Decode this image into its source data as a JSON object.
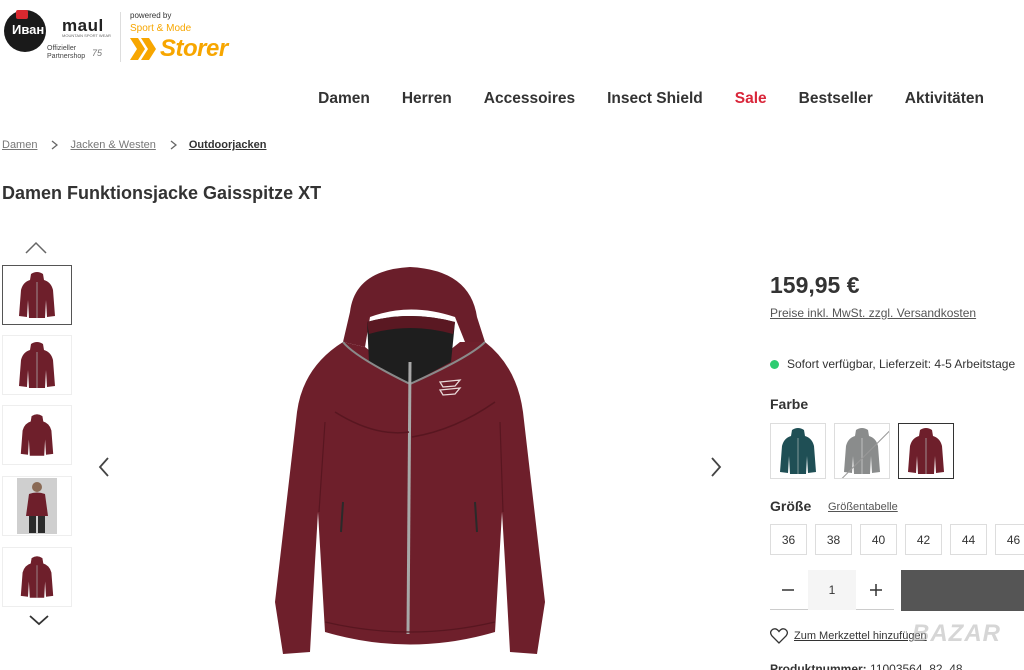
{
  "header": {
    "brand_main": "maul",
    "brand_overlay": "Иван",
    "brand_tagline": "MOUNTAIN SPORT WEAR",
    "partnershop": "Offizieller Partnershop",
    "anniversary": "75",
    "powered_by": "powered by",
    "sport_mode": "Sport & Mode",
    "storer": "Storer"
  },
  "nav": {
    "items": [
      "Damen",
      "Herren",
      "Accessoires",
      "Insect Shield",
      "Sale",
      "Bestseller",
      "Aktivitäten"
    ]
  },
  "breadcrumb": [
    "Damen",
    "Jacken & Westen",
    "Outdoorjacken"
  ],
  "product": {
    "title": "Damen Funktionsjacke Gaisspitze XT",
    "price": "159,95 €",
    "price_note": "Preise inkl. MwSt. zzgl. Versandkosten",
    "stock": "Sofort verfügbar, Lieferzeit: 4-5 Arbeitstage",
    "color_label": "Farbe",
    "colors": [
      {
        "name": "dark-teal",
        "hex": "#1f4f55",
        "available": true
      },
      {
        "name": "grey",
        "hex": "#8a8c8c",
        "available": false
      },
      {
        "name": "bordeaux",
        "hex": "#6e1f2b",
        "available": true,
        "selected": true
      }
    ],
    "size_label": "Größe",
    "size_chart": "Größentabelle",
    "sizes": [
      "36",
      "38",
      "40",
      "42",
      "44",
      "46"
    ],
    "quantity": "1",
    "wishlist": "Zum Merkzettel hinzufügen",
    "product_number_label": "Produktnummer:",
    "product_number": "11003564_82_48"
  },
  "watermark": "BAZAR",
  "colors": {
    "accent": "#f7a600",
    "sale": "#d9263a",
    "jacket": "#6e1f2b",
    "instock": "#2ecc71"
  }
}
